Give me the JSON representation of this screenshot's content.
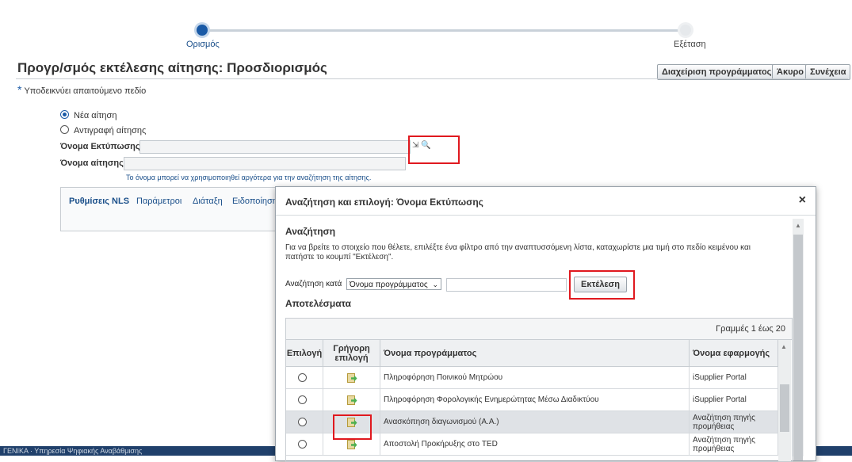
{
  "train": {
    "steps": [
      {
        "label": "Ορισμός"
      },
      {
        "label": "Εξέταση"
      }
    ]
  },
  "page": {
    "title": "Προγρ/σμός εκτέλεσης αίτησης: Προσδιορισμός"
  },
  "toolbar": {
    "manage_label": "Διαχείριση προγράμματος",
    "cancel_label": "Άκυρο",
    "continue_label": "Συνέχεια"
  },
  "required_note": "Υποδεικνύει απαιτούμενο πεδίο",
  "form": {
    "radio_new": "Νέα αίτηση",
    "radio_copy": "Αντιγραφή αίτησης",
    "print_name_label": "Όνομα Εκτύπωσης",
    "request_name_label": "Όνομα αίτησης",
    "hint": "Το όνομα μπορεί να χρησιμοποιηθεί αργότερα για την αναζήτηση της αίτησης."
  },
  "tabs": [
    "Ρυθμίσεις NLS",
    "Παράμετροι",
    "Διάταξη",
    "Ειδοποίηση"
  ],
  "footer_text": "ΓΕΝΙΚΑ · Υπηρεσία Ψηφιακής Αναβάθμισης",
  "dialog": {
    "title": "Αναζήτηση και επιλογή: Όνομα Εκτύπωσης",
    "close": "×",
    "search_heading": "Αναζήτηση",
    "instructions": "Για να βρείτε το στοιχείο που θέλετε, επιλέξτε ένα φίλτρο από την αναπτυσσόμενη λίστα, καταχωρίστε μια τιμή στο πεδίο κειμένου και πατήστε το κουμπί \"Εκτέλεση\".",
    "search_by_label": "Αναζήτηση κατά",
    "search_by_value": "Όνομα προγράμματος",
    "go_label": "Εκτέλεση",
    "results_heading": "Αποτελέσματα",
    "rows_label": "Γραμμές 1 έως 20",
    "columns": {
      "select": "Επιλογή",
      "quick": "Γρήγορη επιλογή",
      "program": "Όνομα προγράμματος",
      "app": "Όνομα εφαρμογής"
    },
    "rows": [
      {
        "program": "Πληροφόρηση Ποινικού Μητρώου",
        "app": "iSupplier Portal"
      },
      {
        "program": "Πληροφόρηση Φορολογικής Ενημερώτητας Μέσω Διαδικτύου",
        "app": "iSupplier Portal"
      },
      {
        "program": "Ανασκόπηση διαγωνισμού (Α.Α.)",
        "app": "Αναζήτηση πηγής προμήθειας"
      },
      {
        "program": "Αποστολή Προκήρυξης στο TED",
        "app": "Αναζήτηση πηγής προμήθειας"
      }
    ]
  },
  "colors": {
    "accent": "#1a5aa6",
    "highlight_box": "#e0191f",
    "selected_row": "#dfe2e6"
  }
}
